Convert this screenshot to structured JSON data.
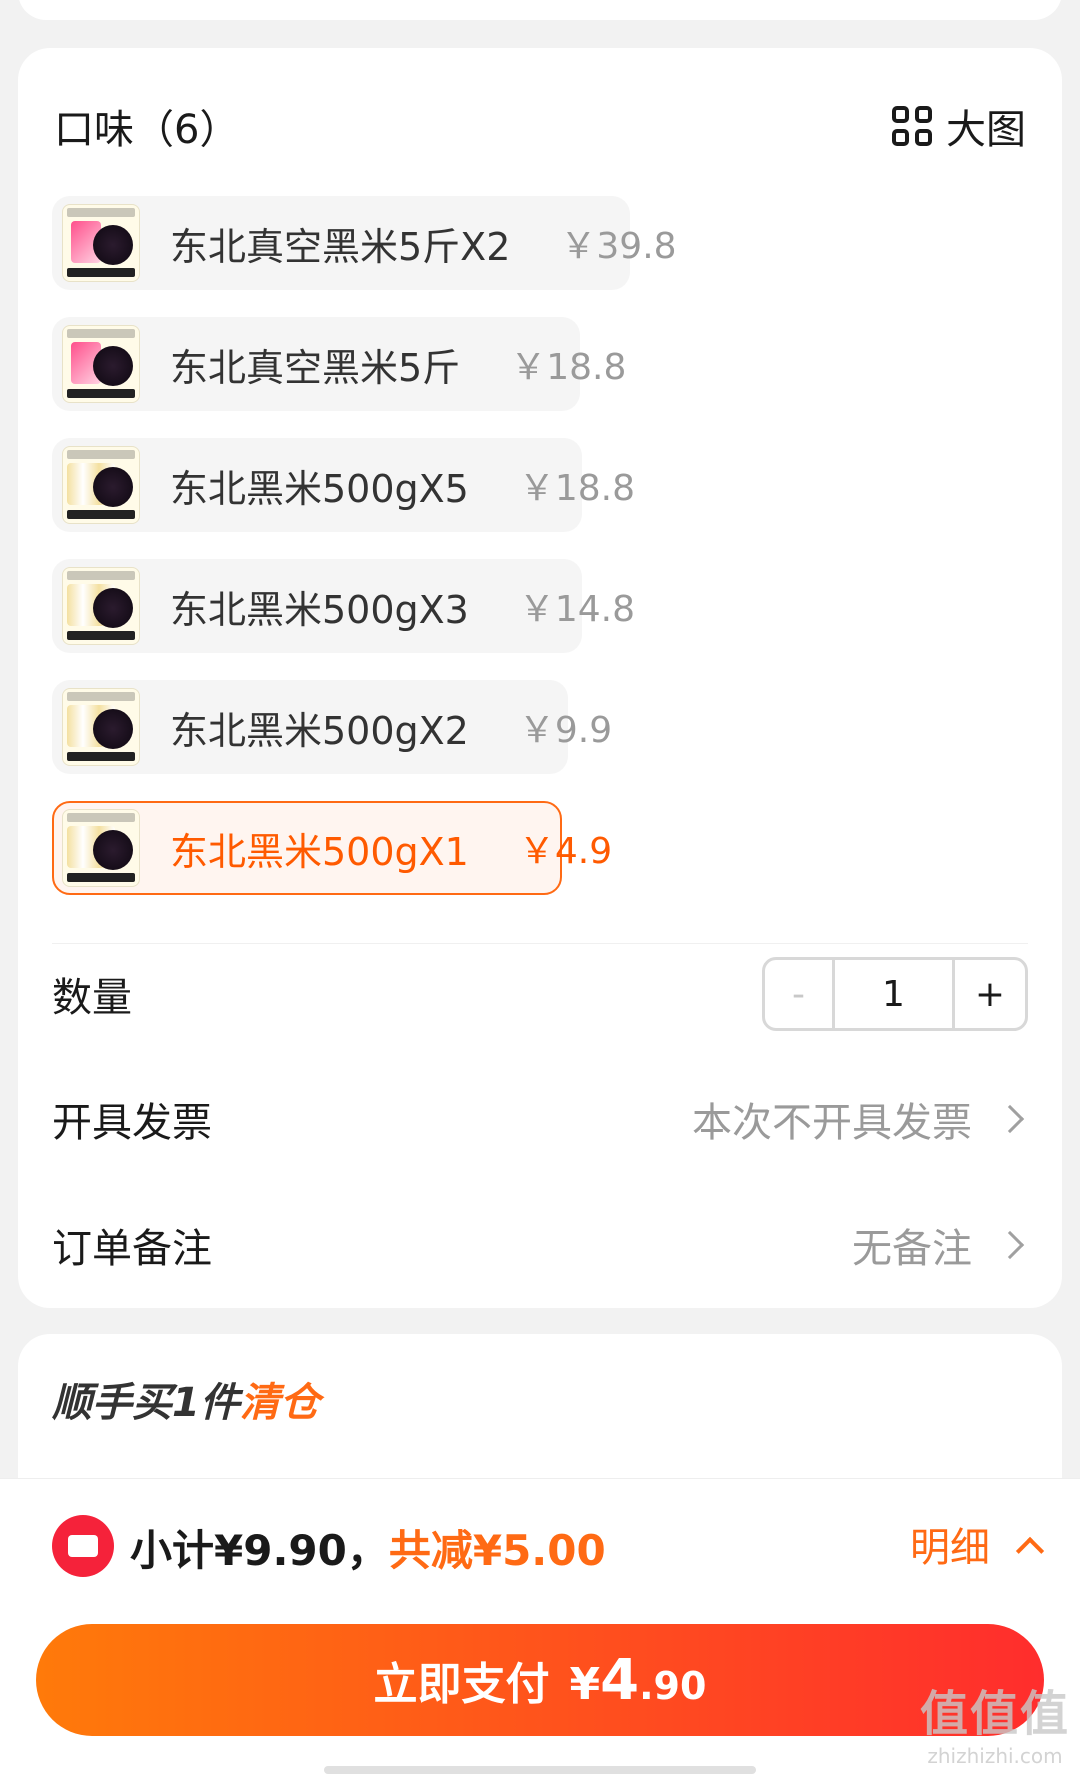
{
  "flavor": {
    "title": "口味（6）",
    "big_view_label": "大图"
  },
  "skus": [
    {
      "name": "东北真空黑米5斤X2",
      "price": "￥39.8",
      "selected": false
    },
    {
      "name": "东北真空黑米5斤",
      "price": "￥18.8",
      "selected": false
    },
    {
      "name": "东北黑米500gX5",
      "price": "￥18.8",
      "selected": false
    },
    {
      "name": "东北黑米500gX3",
      "price": "￥14.8",
      "selected": false
    },
    {
      "name": "东北黑米500gX2",
      "price": "￥9.9",
      "selected": false
    },
    {
      "name": "东北黑米500gX1",
      "price": "￥4.9",
      "selected": true
    }
  ],
  "quantity": {
    "label": "数量",
    "minus": "-",
    "value": "1",
    "plus": "+"
  },
  "invoice": {
    "label": "开具发票",
    "value": "本次不开具发票"
  },
  "remark": {
    "label": "订单备注",
    "value": "无备注"
  },
  "addon": {
    "title": "顺手买1件",
    "highlight": "清仓"
  },
  "summary": {
    "subtotal": "小计¥9.90，",
    "discount": "共减¥5.00",
    "detail_label": "明细"
  },
  "pay": {
    "label": "立即支付",
    "currency": "¥",
    "amount_int": "4",
    "amount_dec": ".90"
  },
  "watermark": {
    "logo": "值值值",
    "site": "zhizhizhi.com"
  },
  "colors": {
    "accent": "#ff6a14",
    "pay_gradient_start": "#ff7a0a",
    "pay_gradient_end": "#ff2d2d"
  }
}
